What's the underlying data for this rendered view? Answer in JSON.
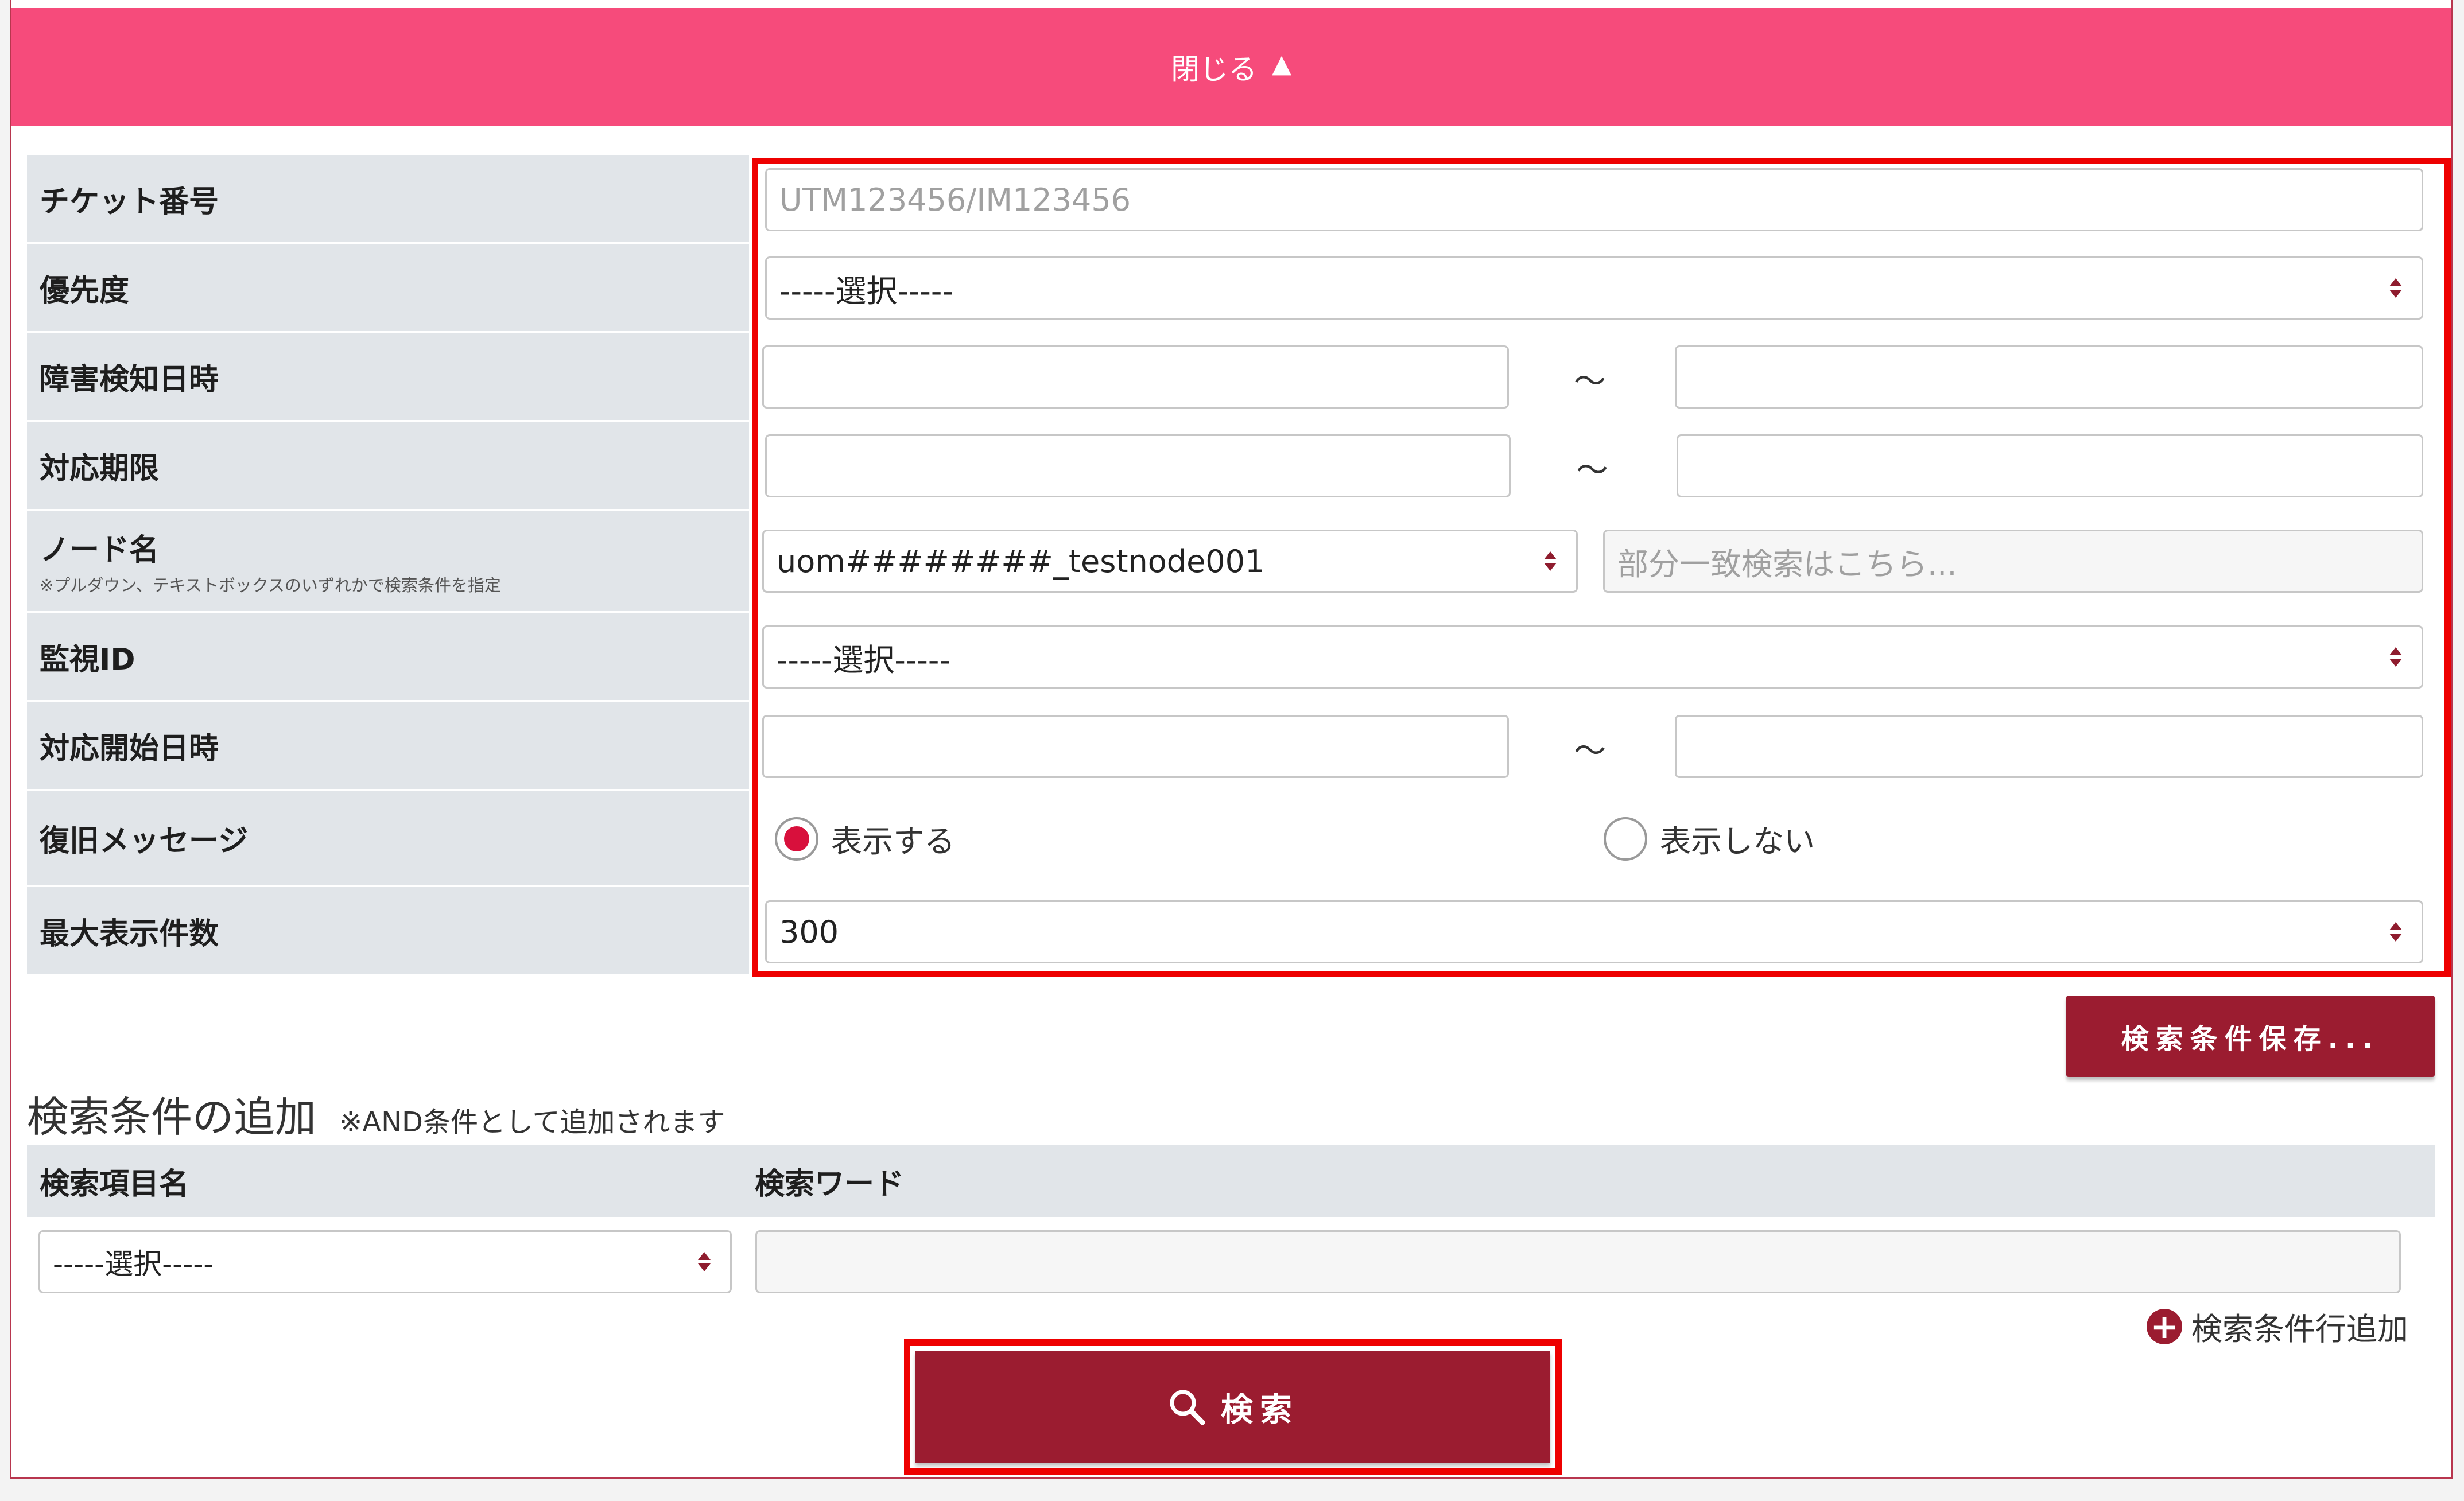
{
  "toggle": {
    "label": "閉じる",
    "icon": "triangle-up-icon"
  },
  "form": {
    "ticket": {
      "label": "チケット番号",
      "placeholder": "UTM123456/IM123456"
    },
    "priority": {
      "label": "優先度",
      "value": "-----選択-----"
    },
    "detect_datetime": {
      "label": "障害検知日時",
      "separator": "～"
    },
    "deadline": {
      "label": "対応期限",
      "separator": "～"
    },
    "node": {
      "label": "ノード名",
      "note": "※プルダウン、テキストボックスのいずれかで検索条件を指定",
      "select_value": "uom########_testnode001",
      "text_placeholder": "部分一致検索はこちら..."
    },
    "monitor_id": {
      "label": "監視ID",
      "value": "-----選択-----"
    },
    "start_datetime": {
      "label": "対応開始日時",
      "separator": "～"
    },
    "recovery": {
      "label": "復旧メッセージ",
      "options": [
        "表示する",
        "表示しない"
      ],
      "selected": "表示する"
    },
    "max_count": {
      "label": "最大表示件数",
      "value": "300"
    }
  },
  "save_button": "検索条件保存...",
  "add_conditions": {
    "title": "検索条件の追加",
    "note": "※AND条件として追加されます",
    "col_item": "検索項目名",
    "col_word": "検索ワード",
    "item_value": "-----選択-----",
    "add_row": "検索条件行追加"
  },
  "search_button": "検索",
  "colors": {
    "bar": "#f64b7b",
    "accent": "#9b1c30",
    "highlight": "#ee0000",
    "radio": "#d8103c"
  }
}
